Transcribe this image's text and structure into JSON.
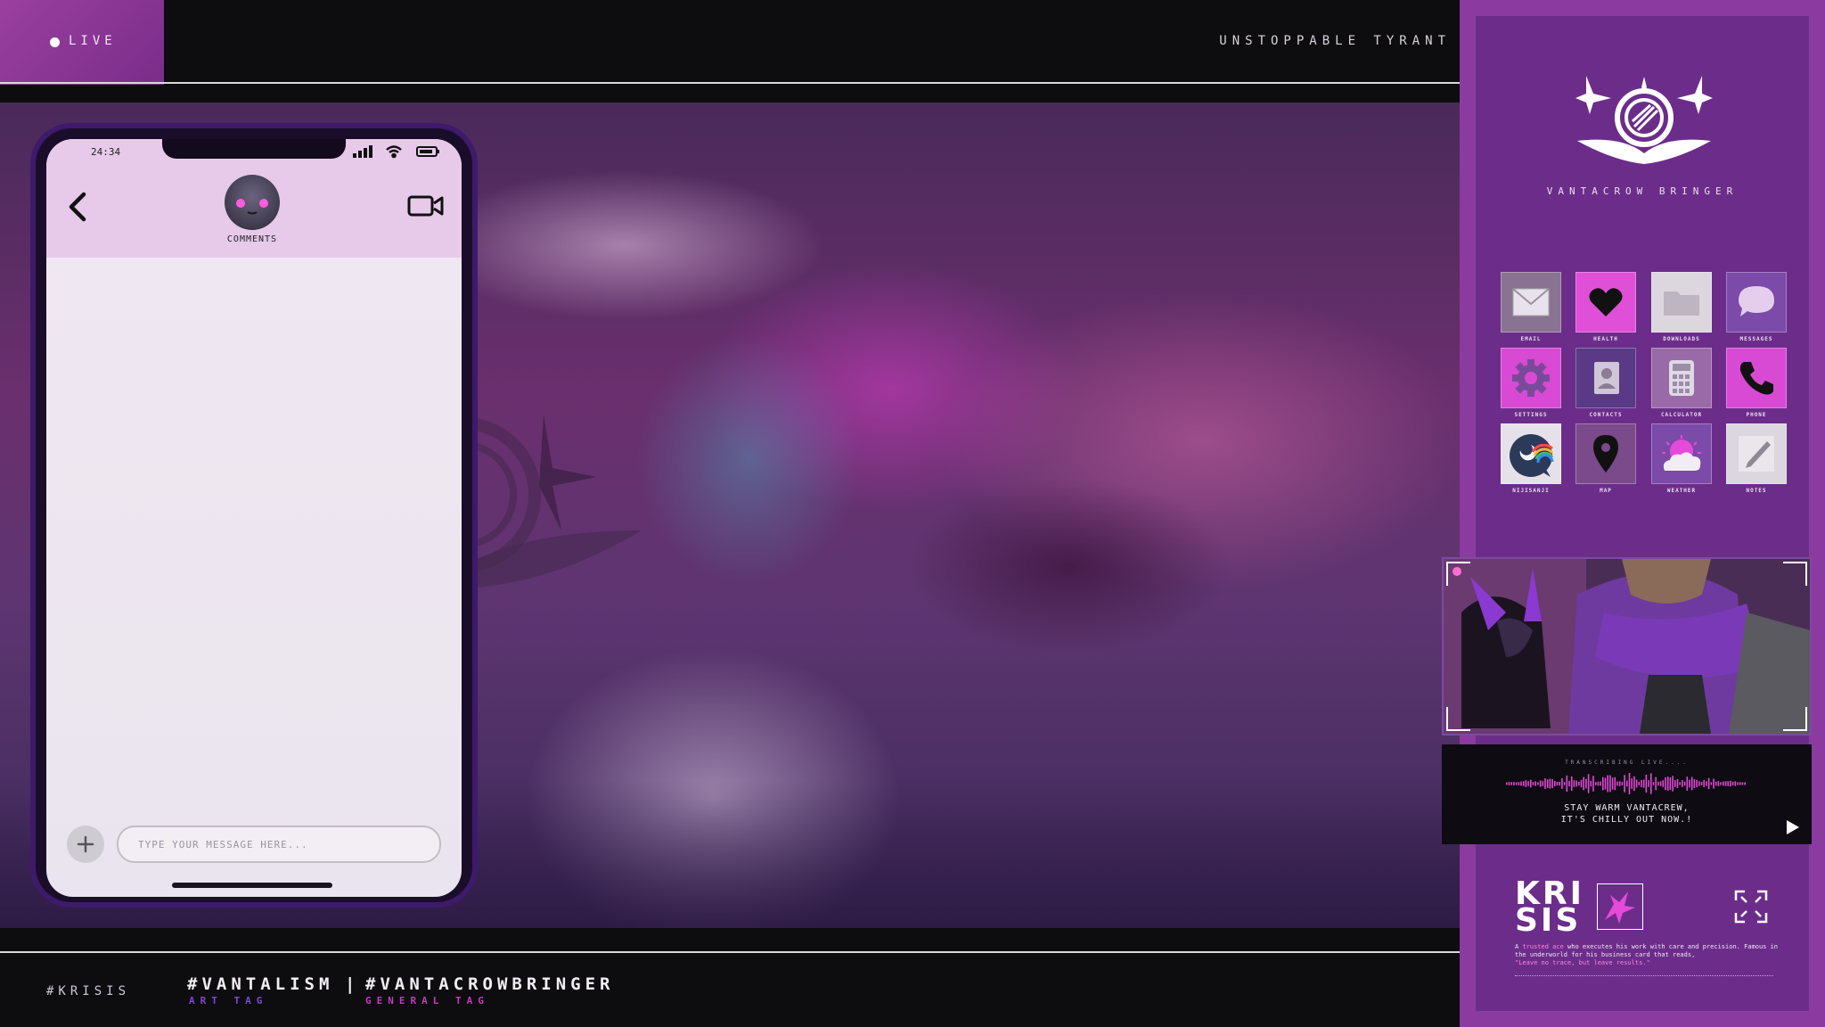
{
  "header": {
    "live_label": "LIVE",
    "title": "UNSTOPPABLE TYRANT"
  },
  "phone": {
    "status_time": "24:34",
    "header_label": "COMMENTS",
    "input_placeholder": "TYPE YOUR MESSAGE HERE..."
  },
  "footer": {
    "handle": "#KRISIS",
    "tags": [
      {
        "tag": "#VANTALISM",
        "label": "ART TAG",
        "color": "#7e4ad0"
      },
      {
        "tag": "#VANTACROWBRINGER",
        "label": "GENERAL TAG",
        "color": "#c03cbc"
      }
    ],
    "separator": "|"
  },
  "sidebar": {
    "brand": "VANTACROW BRINGER",
    "apps": [
      {
        "label": "EMAIL",
        "icon": "mail-icon"
      },
      {
        "label": "HEALTH",
        "icon": "heart-icon"
      },
      {
        "label": "DOWNLOADS",
        "icon": "folder-icon"
      },
      {
        "label": "MESSAGES",
        "icon": "chat-bubble-icon"
      },
      {
        "label": "SETTINGS",
        "icon": "gear-icon"
      },
      {
        "label": "CONTACTS",
        "icon": "contacts-icon"
      },
      {
        "label": "CALCULATOR",
        "icon": "calculator-icon"
      },
      {
        "label": "PHONE",
        "icon": "phone-icon"
      },
      {
        "label": "NIJISANJI",
        "icon": "nijisanji-icon"
      },
      {
        "label": "MAP",
        "icon": "map-pin-icon"
      },
      {
        "label": "WEATHER",
        "icon": "weather-icon"
      },
      {
        "label": "NOTES",
        "icon": "notes-icon"
      }
    ],
    "transcription": {
      "label": "TRANSCRIBING LIVE....",
      "line1": "STAY WARM VANTACREW,",
      "line2": "IT'S CHILLY OUT NOW.!"
    },
    "profile": {
      "name_line1": "KRI",
      "name_line2": "SIS",
      "bio_lead": "A ",
      "bio_hl": "trusted ace",
      "bio_rest": " who executes his work with care and precision. Famous in the underworld for his business card that reads,",
      "bio_quote": "\"Leave no trace, but leave results.\""
    }
  },
  "colors": {
    "accent_purple": "#6c2d8a",
    "accent_magenta": "#c03cbc",
    "phone_header": "#e7c9ea"
  }
}
